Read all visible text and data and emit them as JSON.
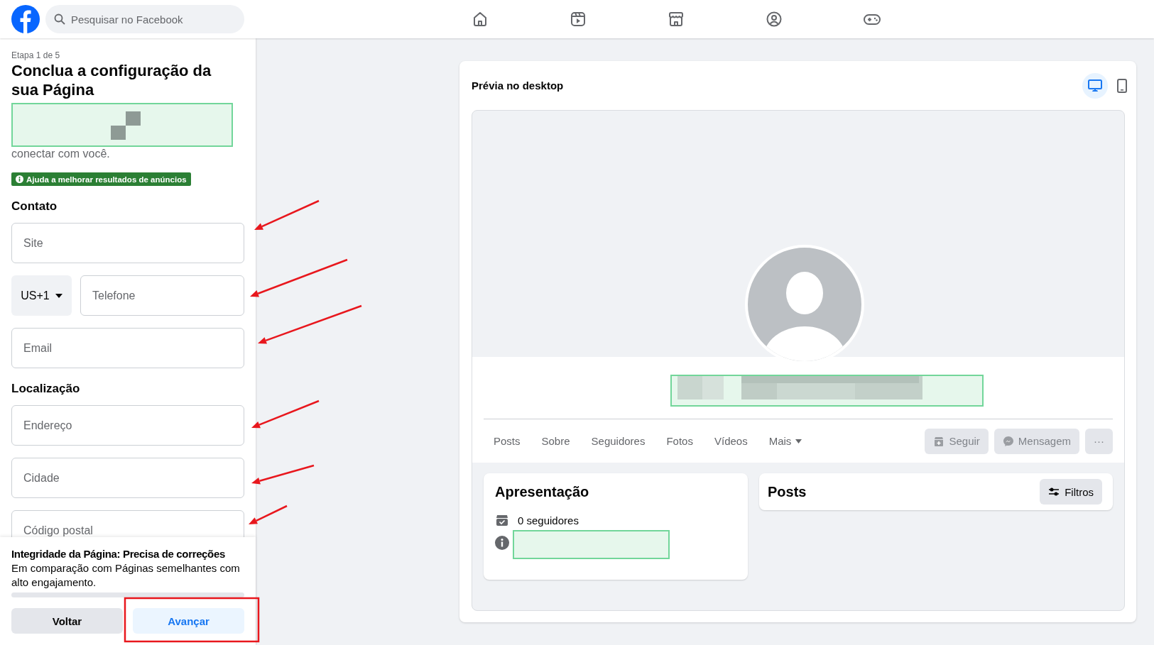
{
  "top_bar": {
    "search": {
      "placeholder": "Pesquisar no Facebook"
    },
    "nav": [
      {
        "kind": "home"
      },
      {
        "kind": "video"
      },
      {
        "kind": "store"
      },
      {
        "kind": "groups"
      },
      {
        "kind": "gaming"
      }
    ]
  },
  "setup_panel": {
    "step": "Etapa 1 de 5",
    "title": "Conclua a configuração da sua Página",
    "description_tail": "conectar com você.",
    "badge": "Ajuda a melhorar resultados de anúncios",
    "sections": [
      {
        "heading": "Contato",
        "fields": [
          {
            "kind": "text",
            "placeholder": "Site"
          },
          {
            "kind": "phone",
            "country": "US+1",
            "placeholder": "Telefone"
          },
          {
            "kind": "text",
            "placeholder": "Email"
          }
        ]
      },
      {
        "heading": "Localização",
        "fields": [
          {
            "kind": "text",
            "placeholder": "Endereço"
          },
          {
            "kind": "text",
            "placeholder": "Cidade"
          },
          {
            "kind": "text",
            "placeholder": "Código postal"
          }
        ]
      }
    ]
  },
  "footer": {
    "progress": {
      "level": 0
    },
    "title": "Integridade da Página: Precisa de correções",
    "text": "Em comparação com Páginas semelhantes com alto engajamento.",
    "buttons": [
      {
        "label": "Voltar",
        "kind": "secondary"
      },
      {
        "label": "Avançar",
        "kind": "primary"
      }
    ]
  },
  "preview": {
    "title": "Prévia no desktop",
    "views": [
      {
        "kind": "desktop",
        "selected": true
      },
      {
        "kind": "mobile",
        "selected": false
      }
    ],
    "tabs": [
      {
        "label": "Posts",
        "kind": "plain"
      },
      {
        "label": "Sobre",
        "kind": "plain"
      },
      {
        "label": "Seguidores",
        "kind": "plain"
      },
      {
        "label": "Fotos",
        "kind": "plain"
      },
      {
        "label": "Vídeos",
        "kind": "plain"
      },
      {
        "label": "Mais",
        "kind": "menu"
      }
    ],
    "actions": [
      {
        "label": "Seguir",
        "kind": "follow",
        "disabled": true
      },
      {
        "label": "Mensagem",
        "kind": "message",
        "disabled": true
      },
      {
        "label": "···",
        "kind": "more",
        "disabled": true
      }
    ],
    "intro": {
      "title": "Apresentação",
      "followers": "0 seguidores"
    },
    "posts": {
      "title": "Posts",
      "filter": "Filtros"
    }
  }
}
